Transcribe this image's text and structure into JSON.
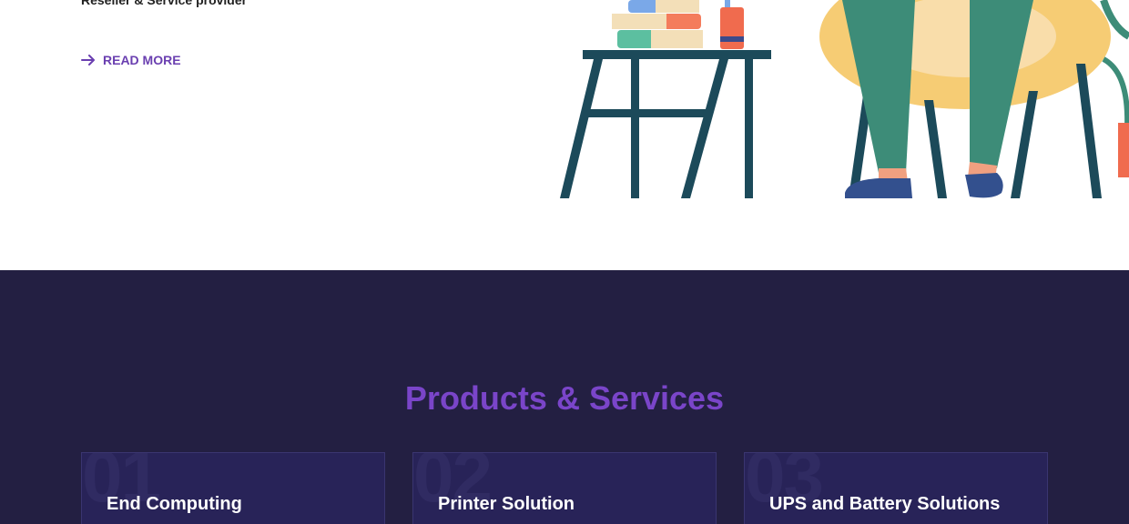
{
  "hero": {
    "tagline": "Reseller & Service provider",
    "read_more": "READ MORE"
  },
  "services": {
    "title": "Products & Services",
    "cards": [
      {
        "number": "01",
        "title": "End Computing"
      },
      {
        "number": "02",
        "title": "Printer Solution"
      },
      {
        "number": "03",
        "title": "UPS and Battery Solutions"
      }
    ]
  },
  "colors": {
    "accent": "#7a45c9",
    "dark_bg": "#231f42",
    "card_bg": "#282358"
  }
}
